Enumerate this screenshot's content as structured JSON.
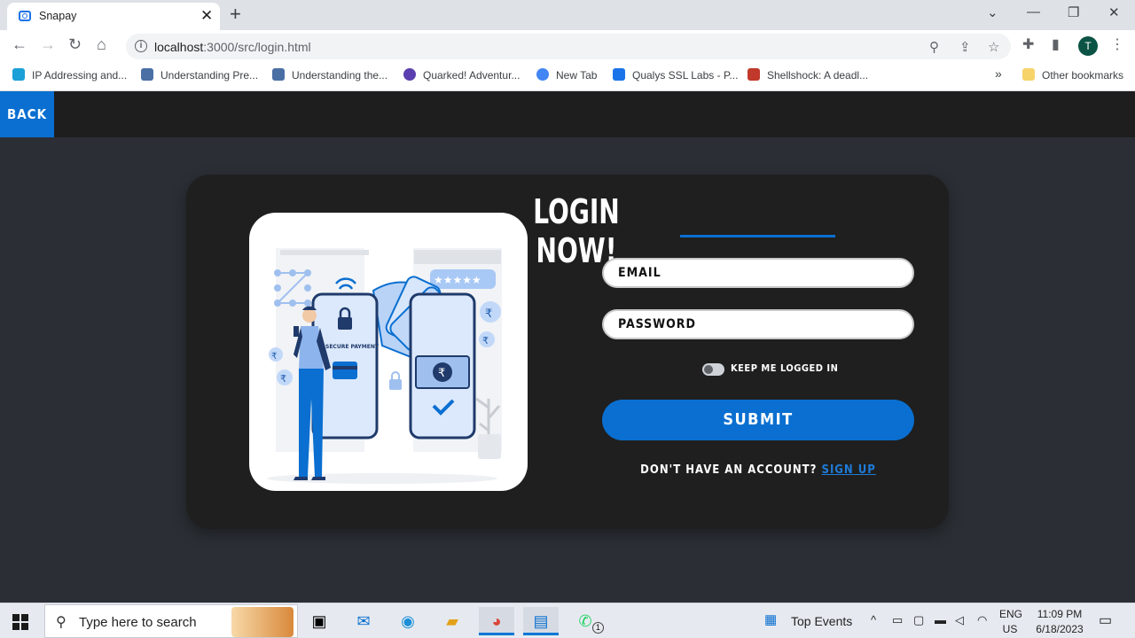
{
  "browser": {
    "tab_title": "Snapay",
    "tab_close": "✕",
    "new_tab": "+",
    "url_host": "localhost",
    "url_path": ":3000/src/login.html",
    "profile_initial": "T",
    "bookmarks": [
      {
        "label": "IP Addressing and...",
        "icon": "cisco-icon",
        "color": "#1ba0d7"
      },
      {
        "label": "Understanding Pre...",
        "icon": "puzzle-icon",
        "color": "#4a6fa5"
      },
      {
        "label": "Understanding the...",
        "icon": "puzzle-icon",
        "color": "#4a6fa5"
      },
      {
        "label": "Quarked! Adventur...",
        "icon": "quark-icon",
        "color": "#5b3fb0"
      },
      {
        "label": "New Tab",
        "icon": "google-icon",
        "color": "#4285f4"
      },
      {
        "label": "Qualys SSL Labs - P...",
        "icon": "lock-icon",
        "color": "#1a73e8"
      },
      {
        "label": "Shellshock: A deadl...",
        "icon": "shell-icon",
        "color": "#c0392b"
      }
    ],
    "bookmarks_overflow": "»",
    "other_bookmarks": "Other bookmarks"
  },
  "page": {
    "back_label": "BACK",
    "title": "LOGIN NOW!",
    "email_placeholder": "EMAIL",
    "password_placeholder": "PASSWORD",
    "keep_logged_in": "KEEP ME LOGGED IN",
    "submit_label": "SUBMIT",
    "signup_prompt": "DON'T HAVE AN ACCOUNT?",
    "signup_link": "SIGN UP",
    "illustration_caption": "SECURE PAYMENT",
    "colors": {
      "accent": "#0a6fd0",
      "card": "#1f1f1f",
      "background": "#2b2f35",
      "topbar": "#1e1e1e"
    }
  },
  "taskbar": {
    "search_placeholder": "Type here to search",
    "widget_label": "Top Events",
    "language": "ENG",
    "region": "US",
    "time": "11:09 PM",
    "date": "6/18/2023",
    "whatsapp_badge": "1"
  }
}
